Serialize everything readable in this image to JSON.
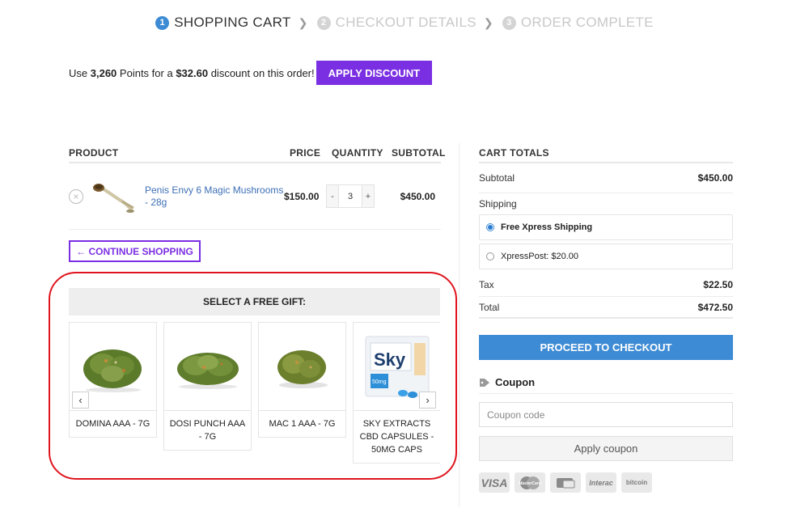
{
  "steps": [
    {
      "num": "1",
      "label": "SHOPPING CART"
    },
    {
      "num": "2",
      "label": "CHECKOUT DETAILS"
    },
    {
      "num": "3",
      "label": "ORDER COMPLETE"
    }
  ],
  "points": {
    "use": "Use",
    "amount": "3,260",
    "points_for": "Points for a",
    "discount": "$32.60",
    "suffix": "discount on this order!",
    "button": "APPLY DISCOUNT"
  },
  "cart": {
    "headers": {
      "product": "PRODUCT",
      "price": "PRICE",
      "quantity": "QUANTITY",
      "subtotal": "SUBTOTAL"
    },
    "item": {
      "remove": "×",
      "name": "Penis Envy 6 Magic Mushrooms - 28g",
      "price": "$150.00",
      "qty": "3",
      "minus": "-",
      "plus": "+",
      "subtotal": "$450.00"
    },
    "continue": "← CONTINUE SHOPPING"
  },
  "gift": {
    "title": "SELECT A FREE GIFT:",
    "items": [
      {
        "name": "DOMINA AAA - 7G"
      },
      {
        "name": "DOSI PUNCH AAA - 7G"
      },
      {
        "name": "MAC 1 AAA - 7G"
      },
      {
        "name": "SKY EXTRACTS CBD CAPSULES - 50MG CAPS"
      }
    ],
    "prev": "‹",
    "next": "›",
    "sky_label": "Sky",
    "sky_mg": "50mg"
  },
  "totals": {
    "title": "CART TOTALS",
    "subtotal_label": "Subtotal",
    "subtotal": "$450.00",
    "shipping_label": "Shipping",
    "ship_options": [
      {
        "label": "Free Xpress Shipping",
        "price": ""
      },
      {
        "label": "XpressPost:",
        "price": "$20.00"
      }
    ],
    "tax_label": "Tax",
    "tax": "$22.50",
    "total_label": "Total",
    "total": "$472.50",
    "checkout": "PROCEED TO CHECKOUT",
    "coupon_title": "Coupon",
    "coupon_placeholder": "Coupon code",
    "apply_coupon": "Apply coupon",
    "payments": [
      "VISA",
      "MasterCard",
      "e-Transfer",
      "Interac",
      "bitcoin"
    ]
  },
  "colors": {
    "accent_purple": "#7b2fe3",
    "accent_blue": "#3d8bd4",
    "highlight_red": "#e0141e"
  }
}
